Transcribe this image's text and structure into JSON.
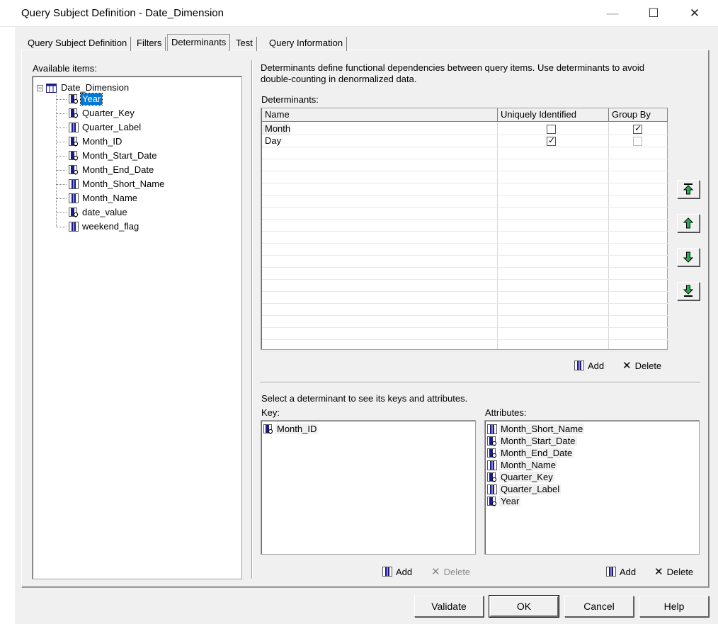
{
  "window": {
    "title": "Query Subject Definition - Date_Dimension",
    "minimize": "—",
    "maximize": "☐",
    "close": "✕"
  },
  "tabs": [
    {
      "label": "Query Subject Definition"
    },
    {
      "label": "Filters"
    },
    {
      "label": "Determinants",
      "active": true
    },
    {
      "label": "Test"
    },
    {
      "label": "Query Information"
    }
  ],
  "available": {
    "label": "Available items:",
    "root": "Date_Dimension",
    "items": [
      {
        "label": "Year",
        "type": "key",
        "selected": true
      },
      {
        "label": "Quarter_Key",
        "type": "key"
      },
      {
        "label": "Quarter_Label",
        "type": "attr"
      },
      {
        "label": "Month_ID",
        "type": "key"
      },
      {
        "label": "Month_Start_Date",
        "type": "key"
      },
      {
        "label": "Month_End_Date",
        "type": "key"
      },
      {
        "label": "Month_Short_Name",
        "type": "attr"
      },
      {
        "label": "Month_Name",
        "type": "attr"
      },
      {
        "label": "date_value",
        "type": "key"
      },
      {
        "label": "weekend_flag",
        "type": "attr"
      }
    ]
  },
  "description": "Determinants define functional dependencies between query items. Use determinants to avoid double-counting in denormalized data.",
  "determinants": {
    "label": "Determinants:",
    "columns": {
      "name": "Name",
      "unique": "Uniquely Identified",
      "groupby": "Group By"
    },
    "rows": [
      {
        "name": "Month",
        "unique": false,
        "groupby": true
      },
      {
        "name": "Day",
        "unique": true,
        "groupby": false
      }
    ],
    "add": "Add",
    "delete": "Delete"
  },
  "detail": {
    "hint": "Select a determinant to see its keys and attributes.",
    "key_label": "Key:",
    "keys": [
      {
        "label": "Month_ID",
        "type": "key"
      }
    ],
    "attr_label": "Attributes:",
    "attributes": [
      {
        "label": "Month_Short_Name",
        "type": "attr"
      },
      {
        "label": "Month_Start_Date",
        "type": "key"
      },
      {
        "label": "Month_End_Date",
        "type": "key"
      },
      {
        "label": "Month_Name",
        "type": "attr"
      },
      {
        "label": "Quarter_Key",
        "type": "key"
      },
      {
        "label": "Quarter_Label",
        "type": "attr"
      },
      {
        "label": "Year",
        "type": "key"
      }
    ],
    "key_add": "Add",
    "key_delete": "Delete",
    "attr_add": "Add",
    "attr_delete": "Delete"
  },
  "buttons": {
    "validate": "Validate",
    "ok": "OK",
    "cancel": "Cancel",
    "help": "Help"
  },
  "colors": {
    "selection": "#0078d7",
    "arrow_green": "#22b14c",
    "column_icon_blue": "#1a1a8c"
  }
}
